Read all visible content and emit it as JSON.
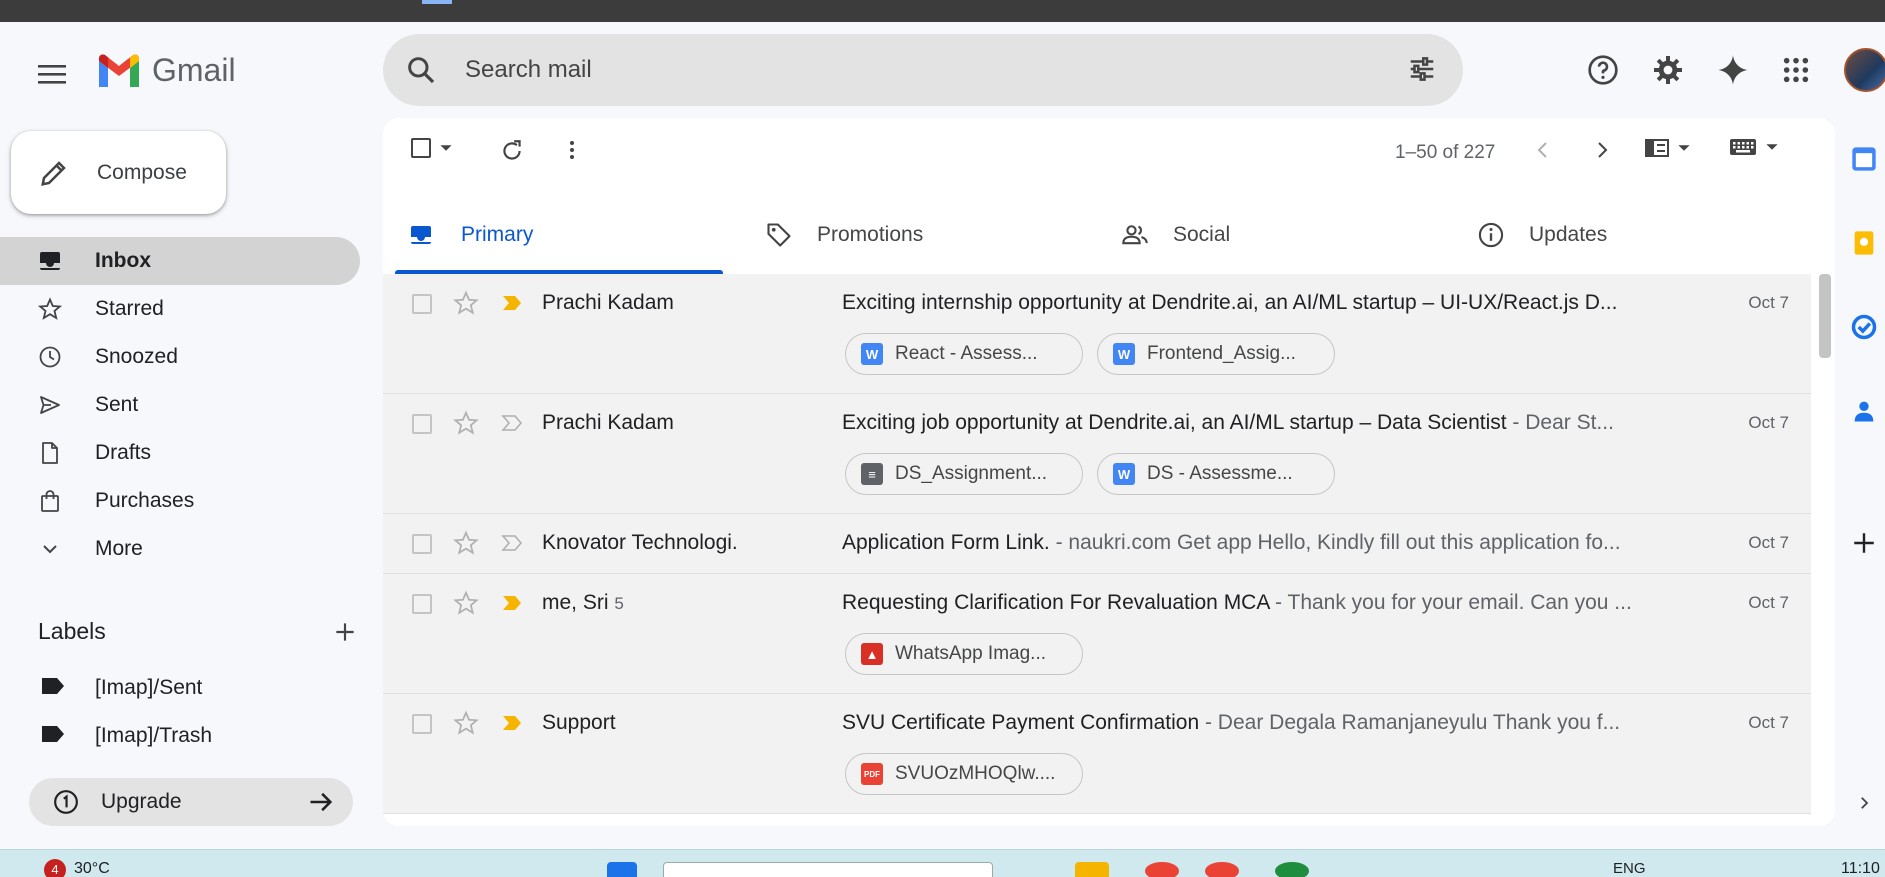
{
  "app": {
    "name": "Gmail"
  },
  "search": {
    "placeholder": "Search mail"
  },
  "compose": {
    "label": "Compose"
  },
  "nav": [
    {
      "label": "Inbox",
      "icon": "inbox-icon",
      "active": true
    },
    {
      "label": "Starred",
      "icon": "star-icon"
    },
    {
      "label": "Snoozed",
      "icon": "clock-icon"
    },
    {
      "label": "Sent",
      "icon": "send-icon"
    },
    {
      "label": "Drafts",
      "icon": "draft-icon"
    },
    {
      "label": "Purchases",
      "icon": "bag-icon"
    },
    {
      "label": "More",
      "icon": "chevron-down-icon"
    }
  ],
  "labels": {
    "title": "Labels",
    "items": [
      {
        "label": "[Imap]/Sent"
      },
      {
        "label": "[Imap]/Trash"
      }
    ]
  },
  "upgrade": {
    "label": "Upgrade"
  },
  "toolbar": {
    "pager": "1–50 of 227"
  },
  "tabs": [
    {
      "label": "Primary",
      "icon": "inbox-icon",
      "active": true
    },
    {
      "label": "Promotions",
      "icon": "tag-icon"
    },
    {
      "label": "Social",
      "icon": "people-icon"
    },
    {
      "label": "Updates",
      "icon": "info-icon"
    }
  ],
  "emails": [
    {
      "sender": "Prachi Kadam",
      "count": "",
      "important": true,
      "subject": "Exciting internship opportunity at Dendrite.ai, an AI/ML startup – UI-UX/React.js D...",
      "snippet": "",
      "date": "Oct 7",
      "attachments": [
        {
          "name": "React - Assess...",
          "type": "word"
        },
        {
          "name": "Frontend_Assig...",
          "type": "word"
        }
      ]
    },
    {
      "sender": "Prachi Kadam",
      "count": "",
      "important": false,
      "subject": "Exciting job opportunity at Dendrite.ai, an AI/ML startup – Data Scientist",
      "snippet": " - Dear St...",
      "date": "Oct 7",
      "attachments": [
        {
          "name": "DS_Assignment...",
          "type": "doc"
        },
        {
          "name": "DS - Assessme...",
          "type": "word"
        }
      ]
    },
    {
      "sender": "Knovator Technologi.",
      "count": "",
      "important": false,
      "subject": "Application Form Link.",
      "snippet": " - naukri.com Get app Hello, Kindly fill out this application fo...",
      "date": "Oct 7",
      "attachments": []
    },
    {
      "sender": "me, Sri",
      "count": "5",
      "important": true,
      "subject": "Requesting Clarification For Revaluation MCA",
      "snippet": " - Thank you for your email. Can you ...",
      "date": "Oct 7",
      "attachments": [
        {
          "name": "WhatsApp Imag...",
          "type": "image"
        }
      ]
    },
    {
      "sender": "Support",
      "count": "",
      "important": true,
      "subject": "SVU Certificate Payment Confirmation",
      "snippet": " - Dear Degala Ramanjaneyulu Thank you f...",
      "date": "Oct 7",
      "attachments": [
        {
          "name": "SVUOzMHOQlw....",
          "type": "pdf"
        }
      ]
    }
  ],
  "taskbar": {
    "badge": "4",
    "weather": "30°C",
    "lang": "ENG",
    "clock": "11:10"
  },
  "colors": {
    "accent": "#0b57d0",
    "important": "#f4b400"
  }
}
